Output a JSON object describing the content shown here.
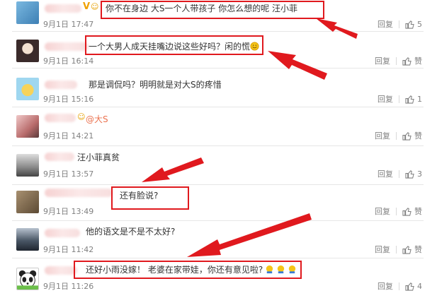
{
  "comments": [
    {
      "content": "你不在身边 大S一个人带孩子 你怎么想的呢 汪小菲",
      "date": "9月1日 17:47",
      "reply": "回复",
      "likes": "5"
    },
    {
      "content": "一个大男人成天挂嘴边说这些好吗？闲的慌",
      "date": "9月1日 16:14",
      "reply": "回复",
      "likes": "赞"
    },
    {
      "content": "那是调侃吗？明明就是对大S的疼惜",
      "date": "9月1日 15:16",
      "reply": "回复",
      "likes": "1"
    },
    {
      "content_mention": "@大S",
      "date": "9月1日 14:21",
      "reply": "回复",
      "likes": "赞"
    },
    {
      "content": "汪小菲真贫",
      "date": "9月1日 13:57",
      "reply": "回复",
      "likes": "3"
    },
    {
      "content": "还有脸说?",
      "date": "9月1日 13:49",
      "reply": "回复",
      "likes": "赞"
    },
    {
      "content": "他的语文是不是不太好?",
      "date": "9月1日 11:42",
      "reply": "回复",
      "likes": "赞"
    },
    {
      "content": "还好小雨没嫁！ 老婆在家带娃，你还有意见啦?",
      "date": "9月1日 11:26",
      "reply": "回复",
      "likes": "4"
    }
  ],
  "colors": {
    "highlight": "#e0191e",
    "mention": "#eb7350",
    "text": "#333333",
    "meta": "#808080"
  }
}
